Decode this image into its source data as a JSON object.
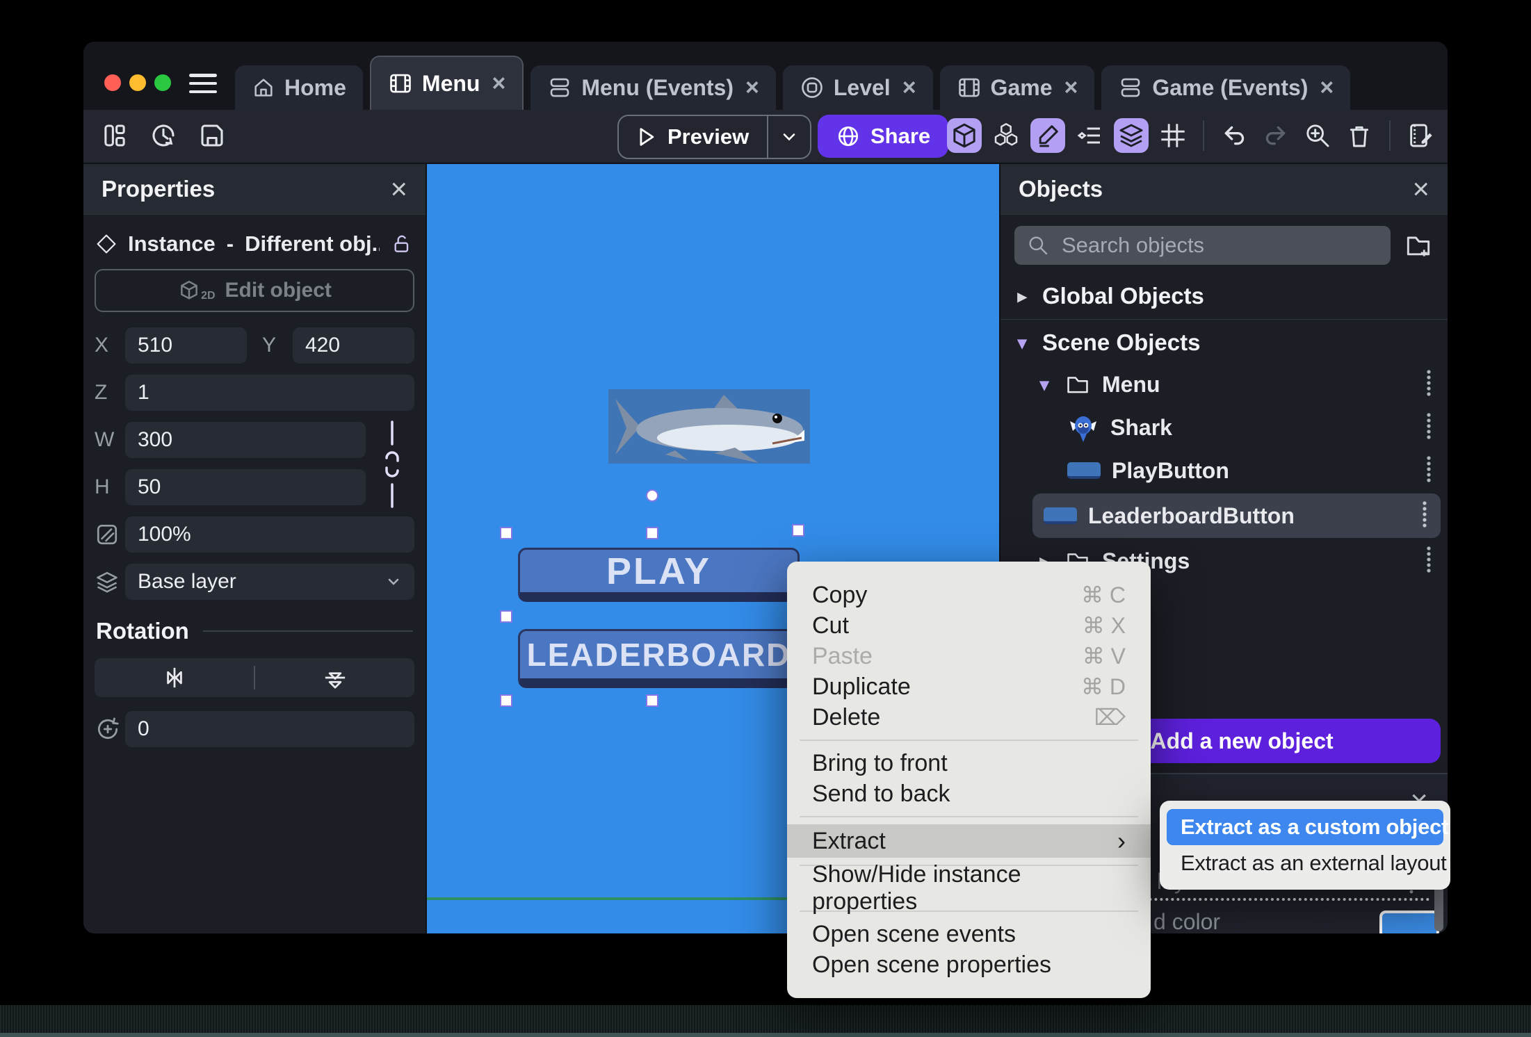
{
  "colors": {
    "accent_purple": "#6233e8",
    "accent_purple_light": "#b3a0f2",
    "add_button_purple": "#5d20dc",
    "canvas_blue": "#338ce8",
    "sprite_background_blue": "#3f75b5",
    "game_button_blue": "#4b77c2",
    "game_button_shadow": "#232e57",
    "scene_border_green": "#2e8f63",
    "submenu_highlight_blue": "#3e87ee",
    "swatch_blue": "#3b8de8",
    "traffic_red": "#ff5f57",
    "traffic_yellow": "#febc2e",
    "traffic_green": "#2ac840"
  },
  "tab_bar": {
    "tabs": [
      {
        "label": "Home",
        "icon": "home-icon",
        "active": false,
        "closable": false
      },
      {
        "label": "Menu",
        "icon": "scene-icon",
        "active": true,
        "closable": true
      },
      {
        "label": "Menu (Events)",
        "icon": "events-icon",
        "active": false,
        "closable": true
      },
      {
        "label": "Level",
        "icon": "external-layout-icon",
        "active": false,
        "closable": true
      },
      {
        "label": "Game",
        "icon": "scene-icon",
        "active": false,
        "closable": true
      },
      {
        "label": "Game (Events)",
        "icon": "events-icon",
        "active": false,
        "closable": true
      }
    ]
  },
  "toolbar": {
    "preview_label": "Preview",
    "share_label": "Share",
    "left_icons": [
      "panels-layout-icon",
      "history-icon",
      "save-icon"
    ],
    "right_icons": [
      {
        "name": "cube-3d-icon",
        "active": true
      },
      {
        "name": "objects-cubes-icon",
        "active": false
      },
      {
        "name": "edit-pencil-icon",
        "active": true
      },
      {
        "name": "instances-list-icon",
        "active": false
      },
      {
        "name": "layers-icon",
        "active": true
      },
      {
        "name": "grid-icon",
        "active": false
      },
      {
        "name": "undo-icon",
        "active": false
      },
      {
        "name": "redo-icon",
        "active": false,
        "disabled": true
      },
      {
        "name": "zoom-in-icon",
        "active": false
      },
      {
        "name": "trash-icon",
        "active": false
      },
      {
        "name": "scene-properties-icon",
        "active": false
      }
    ]
  },
  "properties_panel": {
    "title": "Properties",
    "instance_type": "Instance",
    "separator": "-",
    "instance_name": "Different obj...",
    "edit_object_label": "Edit object",
    "edit_object_icon_label": "2D",
    "x_label": "X",
    "x_value": "510",
    "y_label": "Y",
    "y_value": "420",
    "z_label": "Z",
    "z_value": "1",
    "w_label": "W",
    "w_value": "300",
    "h_label": "H",
    "h_value": "50",
    "opacity_value": "100%",
    "layer_value": "Base layer",
    "rotation_title": "Rotation",
    "rotation_value": "0"
  },
  "canvas": {
    "play_label": "PLAY",
    "leaderboard_label": "LEADERBOARD"
  },
  "objects_panel": {
    "title": "Objects",
    "search_placeholder": "Search objects",
    "global_objects_label": "Global Objects",
    "scene_objects_label": "Scene Objects",
    "folders": [
      {
        "name": "Menu",
        "expanded": true
      },
      {
        "name": "Settings",
        "expanded": false
      }
    ],
    "menu_children": [
      {
        "name": "Shark",
        "thumb": "shark-thumbnail",
        "selected": false
      },
      {
        "name": "PlayButton",
        "thumb": "button-thumbnail",
        "selected": false
      },
      {
        "name": "LeaderboardButton",
        "thumb": "button-thumbnail",
        "selected": true
      }
    ],
    "add_object_label": "Add a new object",
    "bottom_panel": {
      "layer_text_fragment": "layer",
      "color_text_fragment": "d color"
    }
  },
  "context_menu": {
    "items": [
      {
        "label": "Copy",
        "shortcut": "⌘ C"
      },
      {
        "label": "Cut",
        "shortcut": "⌘ X"
      },
      {
        "label": "Paste",
        "shortcut": "⌘ V",
        "disabled": true
      },
      {
        "label": "Duplicate",
        "shortcut": "⌘ D"
      },
      {
        "label": "Delete",
        "shortcut": "⌦"
      },
      {
        "type": "divider"
      },
      {
        "label": "Bring to front"
      },
      {
        "label": "Send to back"
      },
      {
        "type": "divider"
      },
      {
        "label": "Extract",
        "highlighted": true,
        "has_submenu": true
      },
      {
        "type": "divider"
      },
      {
        "label": "Show/Hide instance properties"
      },
      {
        "type": "divider"
      },
      {
        "label": "Open scene events"
      },
      {
        "label": "Open scene properties"
      }
    ]
  },
  "extract_submenu": {
    "items": [
      {
        "label": "Extract as a custom object",
        "highlighted": true
      },
      {
        "label": "Extract as an external layout"
      }
    ]
  }
}
